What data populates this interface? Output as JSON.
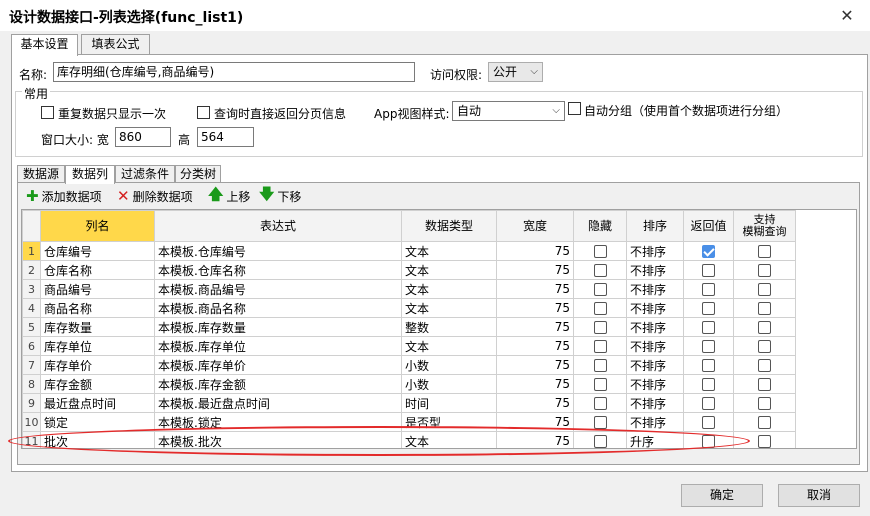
{
  "window": {
    "title": "设计数据接口-列表选择(func_list1)",
    "close_glyph": "✕"
  },
  "main_tabs": [
    {
      "label": "基本设置"
    },
    {
      "label": "填表公式"
    }
  ],
  "basic": {
    "name_label": "名称:",
    "name_value": "库存明细(仓库编号,商品编号)",
    "access_label": "访问权限:",
    "access_value": "公开",
    "group_title": "常用",
    "chk_repeat_label": "重复数据只显示一次",
    "chk_query_label": "查询时直接返回分页信息",
    "app_style_label": "App视图样式:",
    "app_style_value": "自动",
    "chk_autogroup_label": "自动分组（使用首个数据项进行分组）",
    "window_size_label": "窗口大小: 宽",
    "width_value": "860",
    "height_label": "高",
    "height_value": "564"
  },
  "inner_tabs": [
    {
      "label": "数据源"
    },
    {
      "label": "数据列"
    },
    {
      "label": "过滤条件"
    },
    {
      "label": "分类树"
    }
  ],
  "toolbar": {
    "add_label": "添加数据项",
    "delete_label": "删除数据项",
    "up_label": "上移",
    "down_label": "下移"
  },
  "columns": [
    "列名",
    "表达式",
    "数据类型",
    "宽度",
    "隐藏",
    "排序",
    "返回值",
    "支持\n模糊查询"
  ],
  "rows": [
    {
      "n": "1",
      "name": "仓库编号",
      "expr": "本模板.仓库编号",
      "type": "文本",
      "width": "75",
      "sort": "不排序",
      "hidden": false,
      "ret": true,
      "fuzzy": false
    },
    {
      "n": "2",
      "name": "仓库名称",
      "expr": "本模板.仓库名称",
      "type": "文本",
      "width": "75",
      "sort": "不排序",
      "hidden": false,
      "ret": false,
      "fuzzy": false
    },
    {
      "n": "3",
      "name": "商品编号",
      "expr": "本模板.商品编号",
      "type": "文本",
      "width": "75",
      "sort": "不排序",
      "hidden": false,
      "ret": false,
      "fuzzy": false
    },
    {
      "n": "4",
      "name": "商品名称",
      "expr": "本模板.商品名称",
      "type": "文本",
      "width": "75",
      "sort": "不排序",
      "hidden": false,
      "ret": false,
      "fuzzy": false
    },
    {
      "n": "5",
      "name": "库存数量",
      "expr": "本模板.库存数量",
      "type": "整数",
      "width": "75",
      "sort": "不排序",
      "hidden": false,
      "ret": false,
      "fuzzy": false
    },
    {
      "n": "6",
      "name": "库存单位",
      "expr": "本模板.库存单位",
      "type": "文本",
      "width": "75",
      "sort": "不排序",
      "hidden": false,
      "ret": false,
      "fuzzy": false
    },
    {
      "n": "7",
      "name": "库存单价",
      "expr": "本模板.库存单价",
      "type": "小数",
      "width": "75",
      "sort": "不排序",
      "hidden": false,
      "ret": false,
      "fuzzy": false
    },
    {
      "n": "8",
      "name": "库存金额",
      "expr": "本模板.库存金额",
      "type": "小数",
      "width": "75",
      "sort": "不排序",
      "hidden": false,
      "ret": false,
      "fuzzy": false
    },
    {
      "n": "9",
      "name": "最近盘点时间",
      "expr": "本模板.最近盘点时间",
      "type": "时间",
      "width": "75",
      "sort": "不排序",
      "hidden": false,
      "ret": false,
      "fuzzy": false
    },
    {
      "n": "10",
      "name": "锁定",
      "expr": "本模板.锁定",
      "type": "是否型",
      "width": "75",
      "sort": "不排序",
      "hidden": false,
      "ret": false,
      "fuzzy": false
    },
    {
      "n": "11",
      "name": "批次",
      "expr": "本模板.批次",
      "type": "文本",
      "width": "75",
      "sort": "升序",
      "hidden": false,
      "ret": false,
      "fuzzy": false
    }
  ],
  "footer": {
    "ok_label": "确定",
    "cancel_label": "取消"
  },
  "colors": {
    "selection": "#ffd84a",
    "highlight": "#e32b2b",
    "check": "#4a8fe7",
    "add_icon": "#1a9a1a",
    "delete_icon": "#d42020"
  }
}
